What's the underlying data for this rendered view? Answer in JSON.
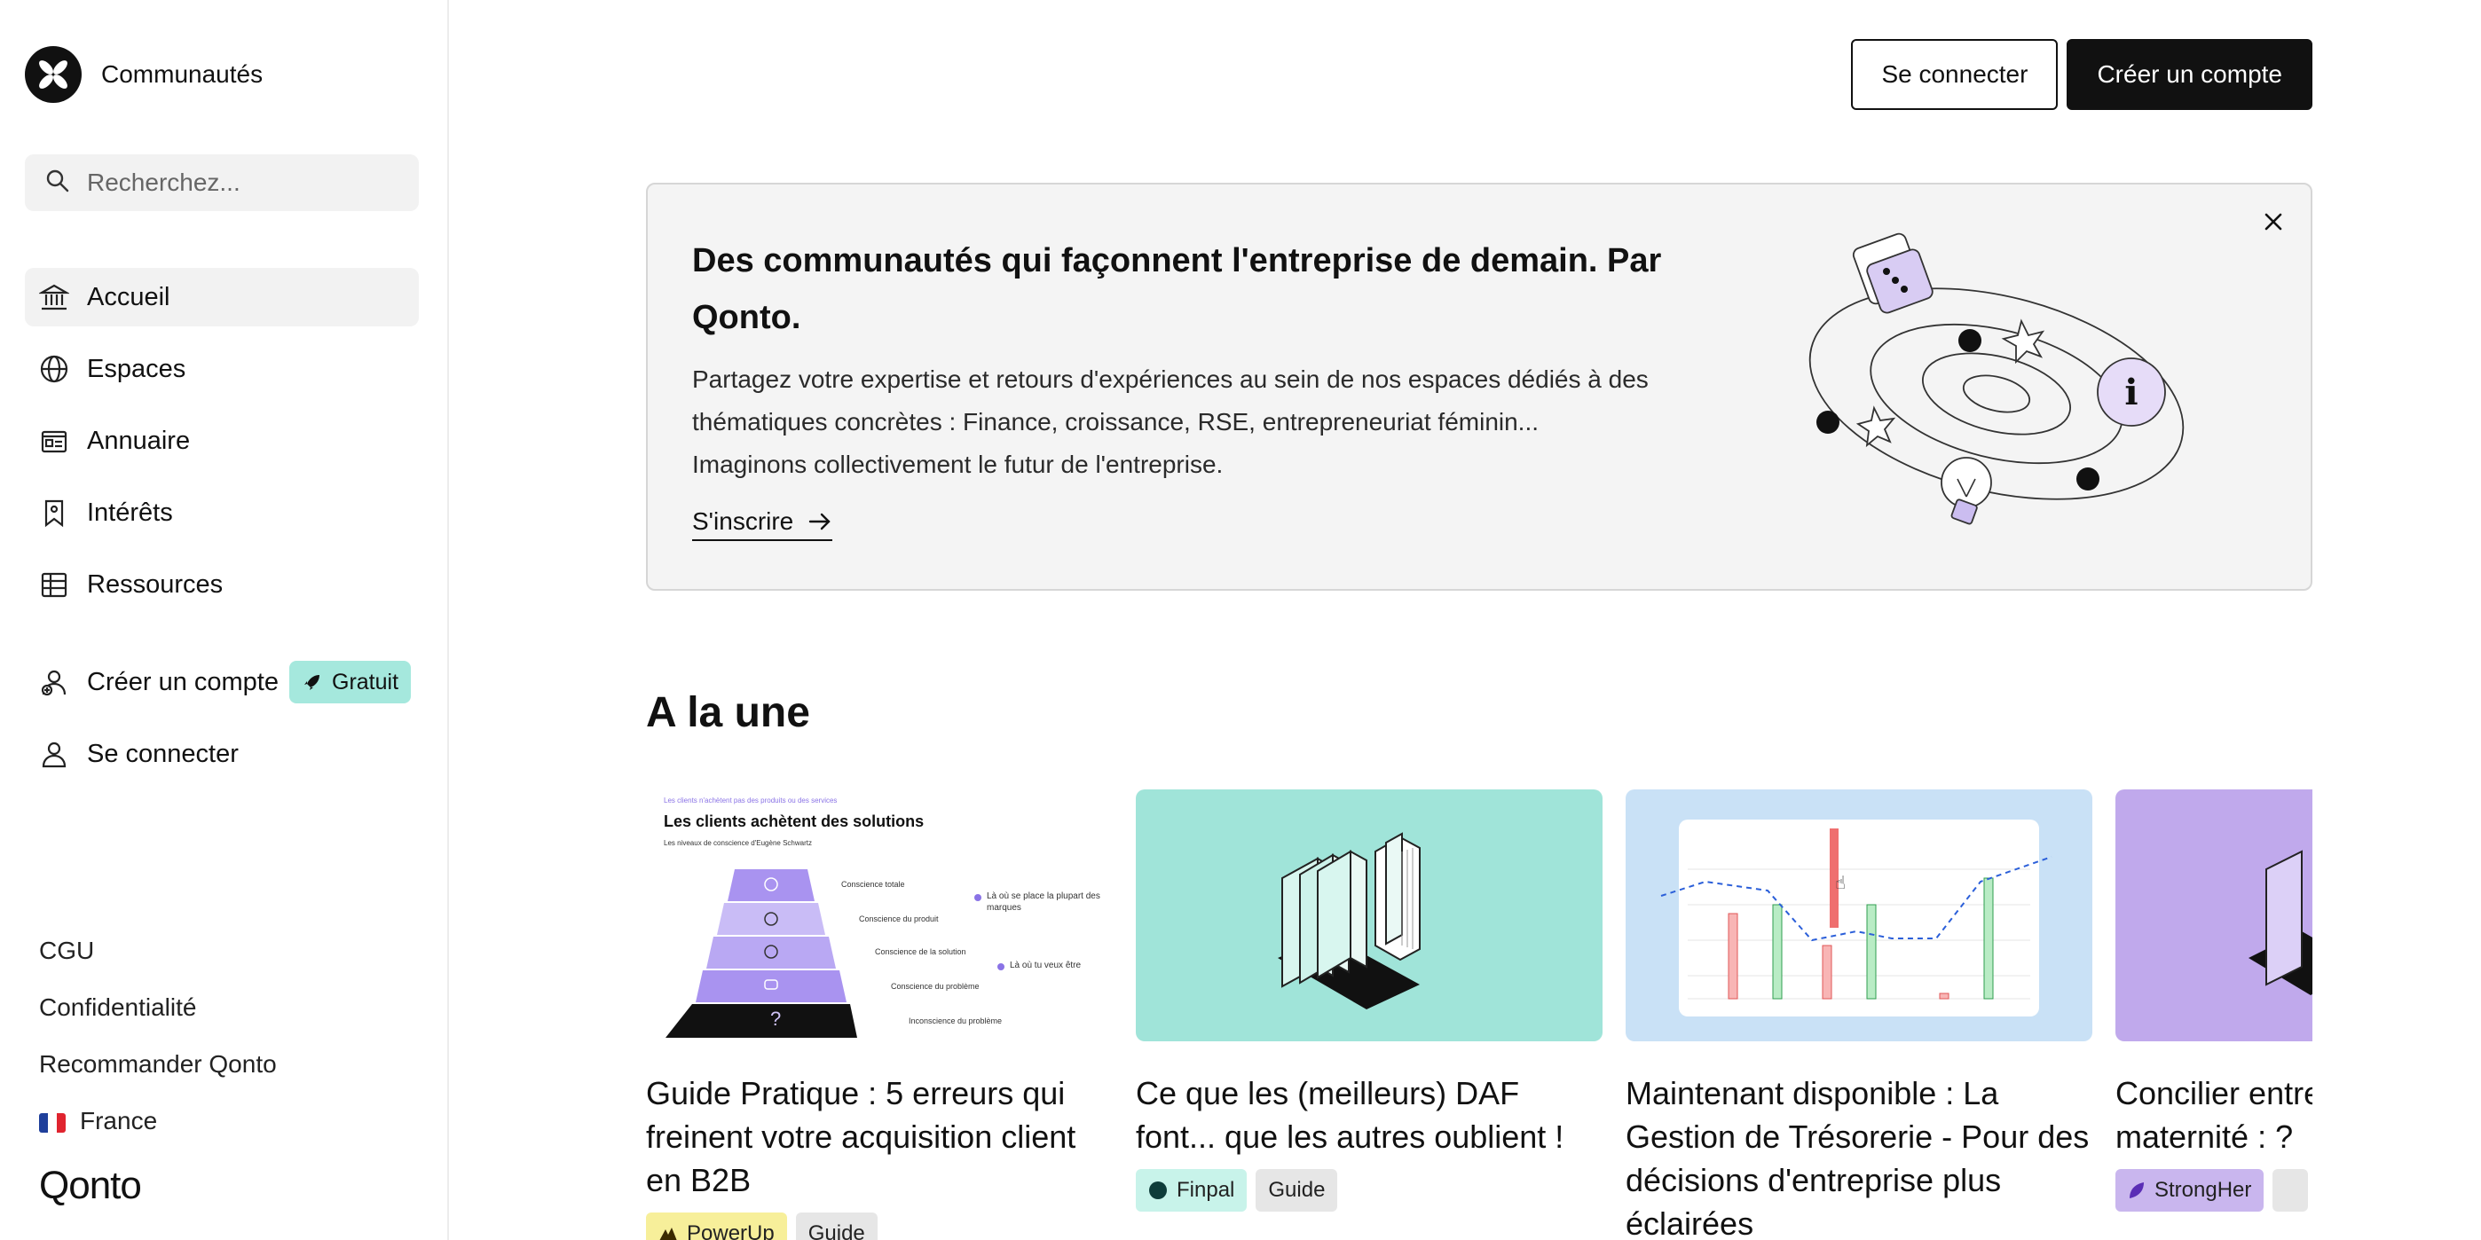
{
  "sidebar": {
    "brand": "Communautés",
    "search_placeholder": "Recherchez...",
    "nav": [
      {
        "label": "Accueil",
        "icon": "bank-icon",
        "active": true
      },
      {
        "label": "Espaces",
        "icon": "globe-icon"
      },
      {
        "label": "Annuaire",
        "icon": "directory-icon"
      },
      {
        "label": "Intérêts",
        "icon": "bookmark-icon"
      },
      {
        "label": "Ressources",
        "icon": "table-icon"
      }
    ],
    "account": {
      "signup_label": "Créer un compte",
      "signup_badge": "Gratuit",
      "login_label": "Se connecter"
    },
    "footer": {
      "cgu": "CGU",
      "privacy": "Confidentialité",
      "recommend": "Recommander Qonto",
      "country": "France"
    },
    "logo_text": "Qonto"
  },
  "topbar": {
    "login": "Se connecter",
    "signup": "Créer un compte"
  },
  "hero": {
    "title": "Des communautés qui façonnent l'entreprise de demain. Par Qonto.",
    "text_line1": "Partagez votre expertise et retours d'expériences au sein de nos espaces dédiés à des thématiques concrètes : Finance, croissance, RSE, entrepreneuriat féminin...",
    "text_line2": "Imaginons collectivement le futur de l'entreprise.",
    "cta": "S'inscrire"
  },
  "featured": {
    "title": "A la une",
    "cards": [
      {
        "title": "Guide Pratique : 5 erreurs qui freinent votre acquisition client en B2B",
        "tags": [
          {
            "label": "PowerUp",
            "color": "#f7ef9a"
          },
          {
            "label": "Guide",
            "color": "#e6e6e6"
          }
        ],
        "image": {
          "kicker": "Les clients n'achètent pas des produits ou des services",
          "heading": "Les clients achètent des solutions",
          "sub": "Les niveaux de conscience d'Eugène Schwartz",
          "levels": [
            "Conscience totale",
            "Conscience du produit",
            "Conscience de la solution",
            "Conscience du problème",
            "Inconscience du problème"
          ],
          "note1": "Là où se place la plupart des marques",
          "note2": "Là où tu veux être",
          "symbol": "?"
        }
      },
      {
        "title": "Ce que les (meilleurs) DAF font... que les autres oublient !",
        "tags": [
          {
            "label": "Finpal",
            "color": "#c8f3ea"
          },
          {
            "label": "Guide",
            "color": "#e6e6e6"
          }
        ]
      },
      {
        "title": "Maintenant disponible : La Gestion de Trésorerie - Pour des décisions d'entreprise plus éclairées",
        "tags": []
      },
      {
        "title": "Concilier entrepreneuriat et maternité : ?",
        "tags": [
          {
            "label": "StrongHer",
            "color": "#c9b6ee"
          }
        ]
      }
    ]
  },
  "colors": {
    "accent_teal": "#a5e8dd",
    "card2_bg": "#a0e4d9",
    "card3_bg": "#c9e1f6",
    "card4_bg": "#c0a9ec",
    "pyramid": "#a993f0"
  }
}
